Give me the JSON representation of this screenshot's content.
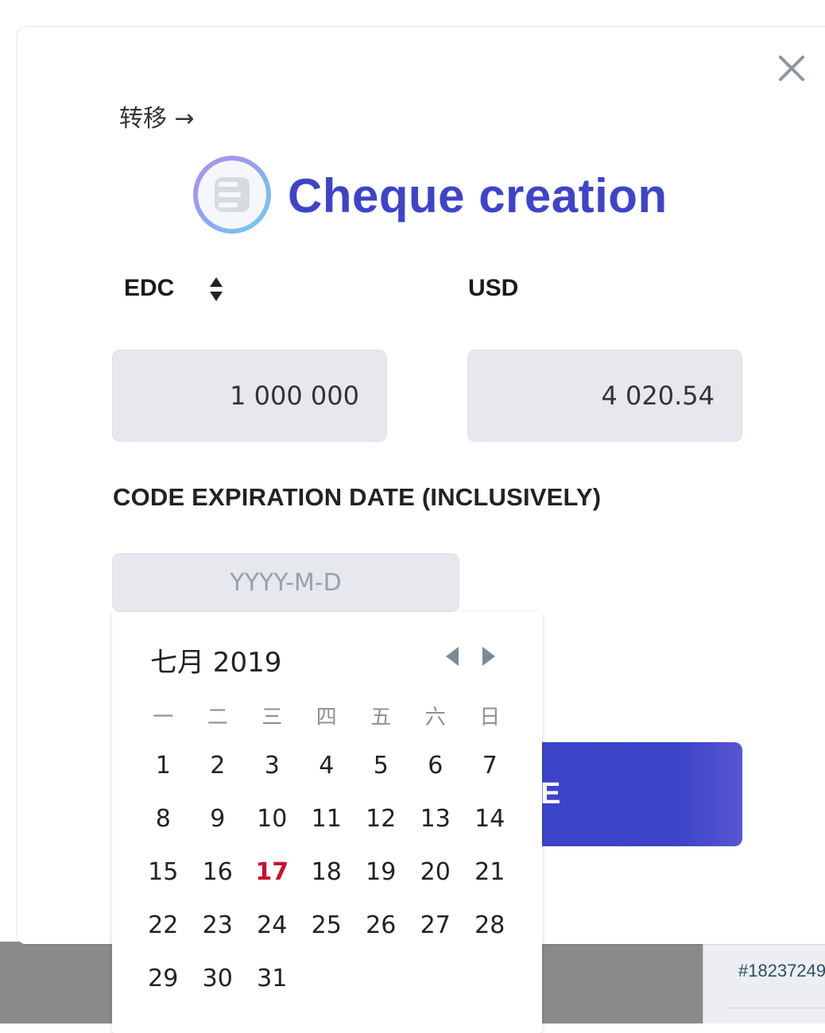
{
  "back_link": "转移 →",
  "title": "Cheque creation",
  "currency_from": "EDC",
  "currency_to": "USD",
  "amount_from": "1 000 000",
  "amount_to": "4 020.54",
  "expiration_label": "CODE EXPIRATION DATE (INCLUSIVELY)",
  "date_placeholder": "YYYY-M-D",
  "submit_label_visible": "E",
  "background_id": "#18237249",
  "colors": {
    "accent": "#3d44c9",
    "today": "#c8102e",
    "field_bg": "#e6e8ee"
  },
  "icons": {
    "close": "close-icon",
    "logo": "edc-logo-icon",
    "sort": "sort-icon",
    "prev": "chevron-left-icon",
    "next": "chevron-right-icon"
  },
  "calendar": {
    "month_label": "七月 2019",
    "weekdays": [
      "一",
      "二",
      "三",
      "四",
      "五",
      "六",
      "日"
    ],
    "weeks": [
      [
        "1",
        "2",
        "3",
        "4",
        "5",
        "6",
        "7"
      ],
      [
        "8",
        "9",
        "10",
        "11",
        "12",
        "13",
        "14"
      ],
      [
        "15",
        "16",
        "17",
        "18",
        "19",
        "20",
        "21"
      ],
      [
        "22",
        "23",
        "24",
        "25",
        "26",
        "27",
        "28"
      ],
      [
        "29",
        "30",
        "31",
        "",
        "",
        "",
        ""
      ]
    ],
    "today": "17"
  }
}
